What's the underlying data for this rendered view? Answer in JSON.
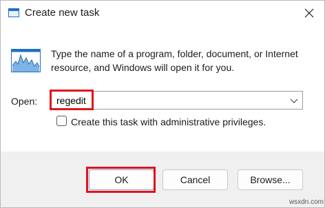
{
  "window": {
    "title": "Create new task",
    "title_icon": "run-dialog-icon",
    "close_icon": "close-icon"
  },
  "content": {
    "description": "Type the name of a program, folder, document, or Internet resource, and Windows will open it for you.",
    "info_icon": "run-program-icon",
    "open_label": "Open:",
    "open_value": "regedit",
    "dropdown_icon": "chevron-down-icon",
    "admin_checkbox_label": "Create this task with administrative privileges.",
    "admin_checked": false
  },
  "buttons": {
    "ok": "OK",
    "cancel": "Cancel",
    "browse": "Browse..."
  },
  "watermark": "wsxdn.com",
  "colors": {
    "highlight": "#e0141e",
    "footer_bg": "#f0f0f0"
  }
}
